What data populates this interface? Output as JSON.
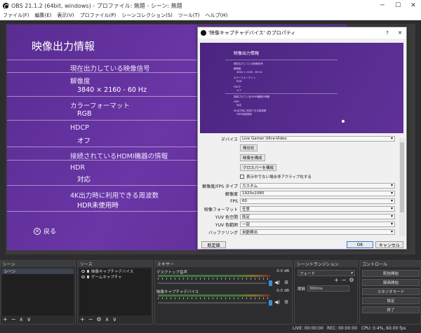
{
  "window": {
    "title": "OBS 21.1.2 (64bit, windows) - プロファイル: 無題 - シーン: 無題"
  },
  "menu": [
    "ファイル(F)",
    "編集(E)",
    "表示(V)",
    "プロファイル(P)",
    "シーンコレクション(S)",
    "ツール(T)",
    "ヘルプ(H)"
  ],
  "ps4": {
    "header": "映像出力情報",
    "section1": "現在出力している映像信号",
    "res_label": "解像度",
    "res_value": "3840 × 2160 - 60 Hz",
    "color_label": "カラーフォーマット",
    "color_value": "RGB",
    "hdcp_label": "HDCP",
    "hdcp_value": "オフ",
    "section2": "接続されているHDMI機器の情報",
    "hdr_label": "HDR",
    "hdr_value": "対応",
    "freq_label": "4K出力時に利用できる周波数",
    "freq_value": "HDR未使用時",
    "back": "戻る"
  },
  "dialog": {
    "title": "'映像キャプチャデバイス' のプロパティ",
    "help": "?",
    "close": "✕",
    "device_label": "デバイス",
    "device_value": "Live Gamer Ultra-Video",
    "deactivate": "無効化",
    "configure": "映像を構成",
    "crossbar": "クロスバーを構成",
    "checkbox": "表示中でない場合非アクティブ化する",
    "restype_label": "解像度/FPS タイプ",
    "restype_value": "カスタム",
    "res_label": "解像度",
    "res_value": "1920x1080",
    "fps_label": "FPS",
    "fps_value": "60",
    "vfmt_label": "映像フォーマット",
    "vfmt_value": "任意",
    "yuvspace_label": "YUV 色空間",
    "yuvspace_value": "既定",
    "yuvrange_label": "YUV 色範囲",
    "yuvrange_value": "一部",
    "buffer_label": "バッファリング",
    "buffer_value": "自動検出",
    "defaults": "既定値",
    "ok": "OK",
    "cancel": "キャンセル"
  },
  "docks": {
    "scenes": {
      "title": "シーン",
      "items": [
        "シーン"
      ]
    },
    "sources": {
      "title": "ソース",
      "items": [
        "映像キャプチャデバイス",
        "ゲームキャプチャ"
      ]
    },
    "mixer": {
      "title": "ミキサー",
      "ch1": "デスクトップ音声",
      "ch1_db": "0.0 dB",
      "ch2": "映像キャプチャデバイス",
      "ch2_db": "0.0 dB"
    },
    "transitions": {
      "title": "シーントランジション",
      "type": "フェード",
      "duration_label": "期間",
      "duration": "300ms"
    },
    "controls": {
      "title": "コントロール",
      "buttons": [
        "配信開始",
        "録画開始",
        "スタジオモード",
        "設定",
        "終了"
      ]
    }
  },
  "status": {
    "live": "LIVE: 00:00:00",
    "rec": "REC: 00:00:00",
    "cpu": "CPU: 0.4%, 60.00 fps"
  }
}
